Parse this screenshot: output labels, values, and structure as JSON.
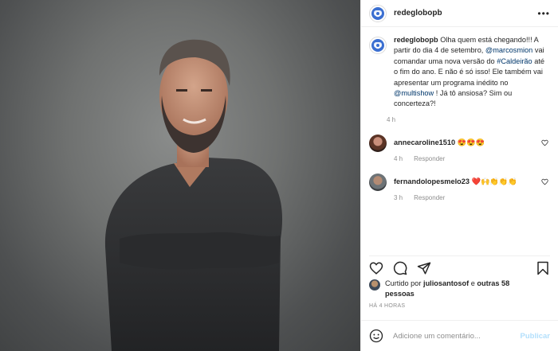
{
  "post": {
    "username": "redeglobopb",
    "more_label": "•••",
    "caption": {
      "username": "redeglobopb",
      "part1": " Olha quem está chegando!!! A partir do dia 4 de setembro, ",
      "mention1": "@marcosmion",
      "part2": " vai comandar uma nova versão do ",
      "hashtag": "#Caldeirão",
      "part3": " até o fim do ano. E não é só isso! Ele também vai apresentar um programa inédito no ",
      "mention2": "@multishow",
      "part4": " ! Já tô ansiosa? Sim ou concerteza?!",
      "time": "4 h"
    },
    "comments": [
      {
        "username": "annecaroline1510",
        "text": " 😍😍😍",
        "time": "4 h",
        "reply_label": "Responder"
      },
      {
        "username": "fernandolopesmelo23",
        "text": " ❤️🙌👏👏👏",
        "time": "3 h",
        "reply_label": "Responder"
      }
    ],
    "likes": {
      "prefix": "Curtido por ",
      "user": "juliosantosof",
      "middle": " e ",
      "others": "outras 58 pessoas"
    },
    "posted_ago": "HÁ 4 HORAS",
    "comment_box": {
      "placeholder": "Adicione um comentário...",
      "publish_label": "Publicar"
    },
    "icons": [
      "globo-logo-icon",
      "heart-icon",
      "comment-icon",
      "share-icon",
      "bookmark-icon",
      "emoji-icon"
    ]
  }
}
